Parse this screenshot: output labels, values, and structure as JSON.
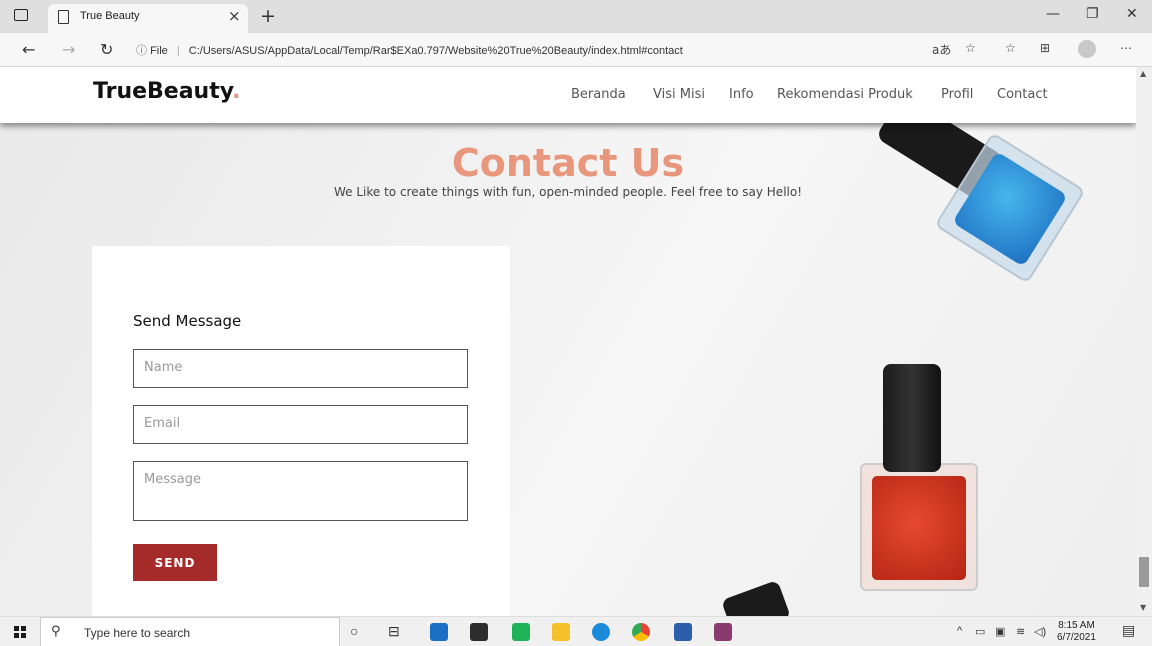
{
  "browser": {
    "tab_title": "True Beauty",
    "url_label": "File",
    "url": "C:/Users/ASUS/AppData/Local/Temp/Rar$EXa0.797/Website%20True%20Beauty/index.html#contact"
  },
  "site": {
    "logo_text": "TrueBeauty",
    "logo_dot": ".",
    "menu": [
      "Beranda",
      "Visi Misi",
      "Info",
      "Rekomendasi Produk",
      "Profil",
      "Contact"
    ]
  },
  "contact": {
    "title": "Contact Us",
    "subtitle": "We Like to create things with fun, open-minded people. Feel free to say Hello!",
    "form_heading": "Send Message",
    "name_placeholder": "Name",
    "email_placeholder": "Email",
    "message_placeholder": "Message",
    "send_label": "SEND"
  },
  "taskbar": {
    "search_placeholder": "Type here to search",
    "time": "8:15 AM",
    "date": "6/7/2021"
  },
  "colors": {
    "accent": "#e8967c",
    "send_button": "#a52a2a"
  }
}
